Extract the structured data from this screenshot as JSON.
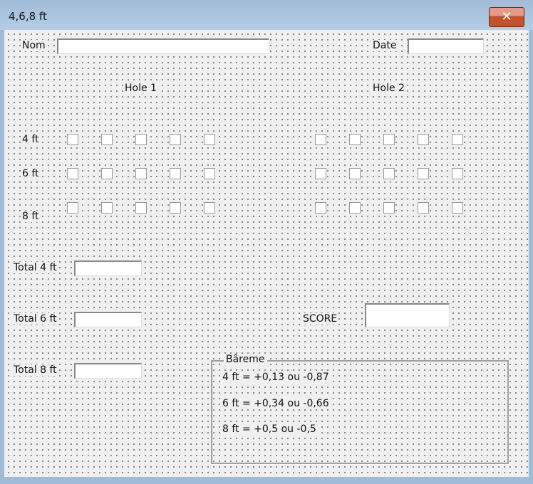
{
  "window": {
    "title": "4,6,8 ft",
    "close_icon": "close-icon"
  },
  "fields": {
    "nom_label": "Nom",
    "date_label": "Date",
    "nom_value": "",
    "date_value": ""
  },
  "holes": [
    {
      "label": "Hole 1"
    },
    {
      "label": "Hole 2"
    }
  ],
  "rows": [
    {
      "label": "4 ft"
    },
    {
      "label": "6 ft"
    },
    {
      "label": "8 ft"
    }
  ],
  "totals": [
    {
      "label": "Total 4 ft",
      "value": ""
    },
    {
      "label": "Total 6 ft",
      "value": ""
    },
    {
      "label": "Total 8 ft",
      "value": ""
    }
  ],
  "score": {
    "label": "SCORE",
    "value": ""
  },
  "bareme": {
    "title": "Bâreme",
    "lines": [
      "4 ft =  +0,13 ou -0,87",
      "6 ft =  +0,34 ou -0,66",
      "8 ft =  +0,5 ou -0,5"
    ]
  }
}
